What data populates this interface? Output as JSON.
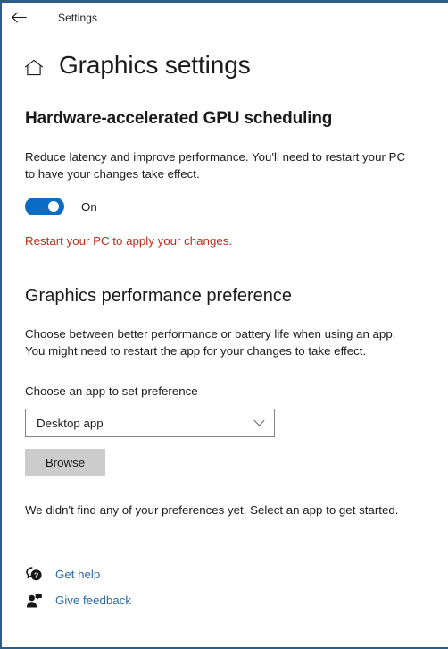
{
  "window": {
    "border_color": "#2c5d86"
  },
  "titlebar": {
    "back_label": "Back",
    "title": "Settings",
    "back_icon": "arrow-left-icon"
  },
  "header": {
    "home_icon": "home-icon",
    "title": "Graphics settings"
  },
  "theme": {
    "accent": "#0a6cc4",
    "link": "#2e68a8",
    "warning": "#c42b1c",
    "text": "#1b1b1b",
    "button_bg": "#cccccc",
    "dropdown_border": "#868686"
  },
  "gpu_scheduling": {
    "heading": "Hardware-accelerated GPU scheduling",
    "description": "Reduce latency and improve performance. You'll need to restart your PC to have your changes take effect.",
    "toggle": {
      "state": "on",
      "label": "On"
    },
    "warning": "Restart your PC to apply your changes."
  },
  "performance_preference": {
    "heading": "Graphics performance preference",
    "description": "Choose between better performance or battery life when using an app. You might need to restart the app for your changes to take effect.",
    "choose_label": "Choose an app to set preference",
    "dropdown": {
      "value": "Desktop app",
      "chevron_icon": "chevron-down-icon",
      "options": [
        "Desktop app"
      ]
    },
    "browse_label": "Browse",
    "empty_message": "We didn't find any of your preferences yet. Select an app to get started."
  },
  "footer": {
    "links": [
      {
        "label": "Get help",
        "icon": "help-question-bubble-icon"
      },
      {
        "label": "Give feedback",
        "icon": "feedback-person-icon"
      }
    ]
  }
}
